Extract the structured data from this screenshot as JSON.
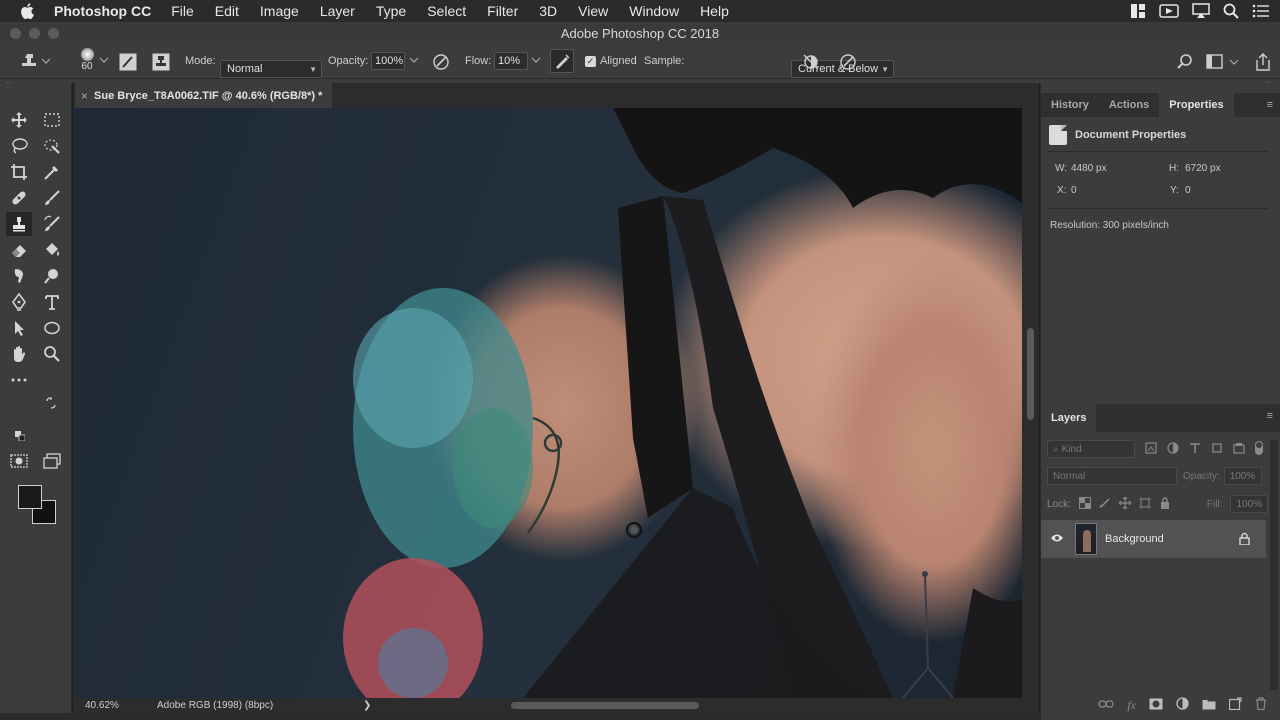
{
  "menubar": {
    "app_name": "Photoshop CC",
    "items": [
      "File",
      "Edit",
      "Image",
      "Layer",
      "Type",
      "Select",
      "Filter",
      "3D",
      "View",
      "Window",
      "Help"
    ]
  },
  "window": {
    "title": "Adobe Photoshop CC 2018"
  },
  "options": {
    "brush_size": "60",
    "mode_label": "Mode:",
    "mode_value": "Normal",
    "opacity_label": "Opacity:",
    "opacity_value": "100%",
    "flow_label": "Flow:",
    "flow_value": "10%",
    "aligned_label": "Aligned",
    "aligned_checked": true,
    "sample_label": "Sample:",
    "sample_value": "Current & Below"
  },
  "document": {
    "tab_title": "Sue Bryce_T8A0062.TIF @ 40.6% (RGB/8*) *"
  },
  "status": {
    "zoom": "40.62%",
    "profile": "Adobe RGB (1998) (8bpc)",
    "arrow": "❯"
  },
  "properties_panel": {
    "tabs": [
      "History",
      "Actions",
      "Properties"
    ],
    "active_tab": "Properties",
    "header": "Document Properties",
    "w_label": "W:",
    "w_value": "4480 px",
    "h_label": "H:",
    "h_value": "6720 px",
    "x_label": "X:",
    "x_value": "0",
    "y_label": "Y:",
    "y_value": "0",
    "resolution": "Resolution: 300 pixels/inch"
  },
  "layers_panel": {
    "tab": "Layers",
    "kind_placeholder": "Kind",
    "blend_mode": "Normal",
    "opacity_label": "Opacity:",
    "opacity_value": "100%",
    "lock_label": "Lock:",
    "fill_label": "Fill:",
    "fill_value": "100%",
    "layers": [
      {
        "name": "Background",
        "visible": true,
        "locked": true
      }
    ]
  },
  "colors": {
    "ui_dark": "#3c3c3c",
    "ui_darker": "#2c2c2c",
    "selected_layer": "#525252",
    "backdrop": "#1f2a36",
    "skin": "#c5937d"
  },
  "icons": {
    "menubar_right": [
      "window-tile-icon",
      "facetime-icon",
      "airplay-icon",
      "spotlight-search-icon",
      "notification-list-icon"
    ]
  }
}
